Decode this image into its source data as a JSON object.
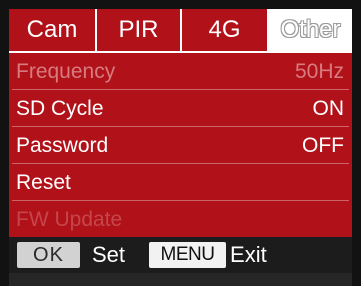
{
  "tabs": [
    {
      "label": "Cam",
      "active": false
    },
    {
      "label": "PIR",
      "active": false
    },
    {
      "label": "4G",
      "active": false
    },
    {
      "label": "Other",
      "active": true
    }
  ],
  "menu": {
    "items": [
      {
        "label": "Frequency",
        "value": "50Hz",
        "state": "disabled"
      },
      {
        "label": "SD Cycle",
        "value": "ON",
        "state": "normal"
      },
      {
        "label": "Password",
        "value": "OFF",
        "state": "normal"
      },
      {
        "label": "Reset",
        "value": "",
        "state": "normal"
      },
      {
        "label": "FW Update",
        "value": "",
        "state": "dim"
      }
    ]
  },
  "footer": {
    "ok_key": "OK",
    "ok_action": "Set",
    "menu_key": "MENU",
    "menu_action": "Exit"
  },
  "colors": {
    "panel_red": "#b1121a",
    "footer_bg": "#1c1c1c",
    "text": "#ffffff"
  }
}
